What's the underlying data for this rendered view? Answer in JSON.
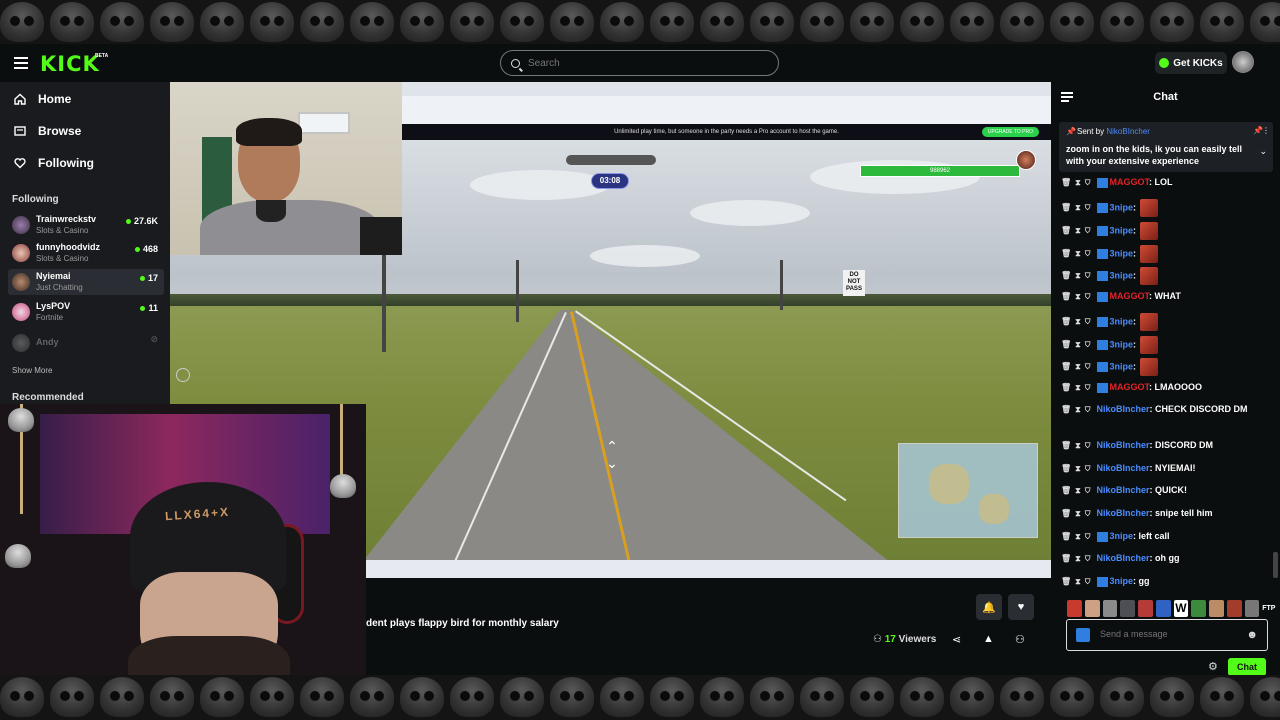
{
  "header": {
    "logo": "KICK",
    "logo_badge": "BETA",
    "search_placeholder": "Search",
    "get_kicks_label": "Get KICKs"
  },
  "sidebar": {
    "nav": [
      {
        "label": "Home",
        "icon": "home-icon"
      },
      {
        "label": "Browse",
        "icon": "browse-icon"
      },
      {
        "label": "Following",
        "icon": "heart-icon"
      }
    ],
    "following_title": "Following",
    "following": [
      {
        "name": "Trainwreckstv",
        "category": "Slots & Casino",
        "viewers": "27.6K",
        "live": true
      },
      {
        "name": "funnyhoodvidz",
        "category": "Slots & Casino",
        "viewers": "468",
        "live": true
      },
      {
        "name": "Nyiemai",
        "category": "Just Chatting",
        "viewers": "17",
        "live": true
      },
      {
        "name": "LysPOV",
        "category": "Fortnite",
        "viewers": "11",
        "live": true
      },
      {
        "name": "Andy",
        "category": "",
        "viewers": "",
        "live": false
      }
    ],
    "show_more": "Show More",
    "recommended_title": "Recommended"
  },
  "stream": {
    "banner_text": "Unlimited play time, but someone in the party needs a Pro account to host the game.",
    "upgrade_label": "UPGRADE TO PRO",
    "timer": "03:08",
    "score": "988962",
    "sign_text": "DO NOT PASS",
    "cam2_beanie_text": "LLX64+X",
    "title": "dent plays flappy bird for monthly salary",
    "viewers_count": "17",
    "viewers_label": "Viewers"
  },
  "chat": {
    "title": "Chat",
    "pinned": {
      "sent_by_label": "Sent by",
      "user": "NikoBIncher",
      "text": "zoom in on the kids, ik you can easily tell with your extensive experience"
    },
    "messages": [
      {
        "user": "MAGGOT",
        "color": "red",
        "text": ": LOL",
        "emote": false,
        "kick": true
      },
      {
        "user": "3nipe",
        "color": "blue",
        "text": ":",
        "emote": true,
        "kick": true
      },
      {
        "user": "3nipe",
        "color": "blue",
        "text": ":",
        "emote": true,
        "kick": true
      },
      {
        "user": "3nipe",
        "color": "blue",
        "text": ":",
        "emote": true,
        "kick": true
      },
      {
        "user": "3nipe",
        "color": "blue",
        "text": ":",
        "emote": true,
        "kick": true
      },
      {
        "user": "MAGGOT",
        "color": "red",
        "text": ": WHAT",
        "emote": false,
        "kick": true
      },
      {
        "user": "3nipe",
        "color": "blue",
        "text": ":",
        "emote": true,
        "kick": true
      },
      {
        "user": "3nipe",
        "color": "blue",
        "text": ":",
        "emote": true,
        "kick": true
      },
      {
        "user": "3nipe",
        "color": "blue",
        "text": ":",
        "emote": true,
        "kick": true
      },
      {
        "user": "MAGGOT",
        "color": "red",
        "text": ": LMAOOOO",
        "emote": false,
        "kick": true
      },
      {
        "user": "NikoBIncher",
        "color": "blue",
        "text": ": CHECK DISCORD DM",
        "emote": false,
        "kick": false
      },
      {
        "user": "NikoBIncher",
        "color": "blue",
        "text": ": DISCORD DM",
        "emote": false,
        "kick": false
      },
      {
        "user": "NikoBIncher",
        "color": "blue",
        "text": ": NYIEMAI!",
        "emote": false,
        "kick": false
      },
      {
        "user": "NikoBIncher",
        "color": "blue",
        "text": ": QUICK!",
        "emote": false,
        "kick": false
      },
      {
        "user": "NikoBIncher",
        "color": "blue",
        "text": ": snipe tell him",
        "emote": false,
        "kick": false
      },
      {
        "user": "3nipe",
        "color": "blue",
        "text": ": left call",
        "emote": false,
        "kick": true
      },
      {
        "user": "NikoBIncher",
        "color": "blue",
        "text": ": oh gg",
        "emote": false,
        "kick": false
      },
      {
        "user": "3nipe",
        "color": "blue",
        "text": ": gg",
        "emote": false,
        "kick": true
      }
    ],
    "emote_ftp": "FTP",
    "input_placeholder": "Send a message",
    "send_label": "Chat"
  },
  "colors": {
    "brand": "#53fc18",
    "user_red": "#e52128",
    "user_blue": "#4a8cff"
  }
}
